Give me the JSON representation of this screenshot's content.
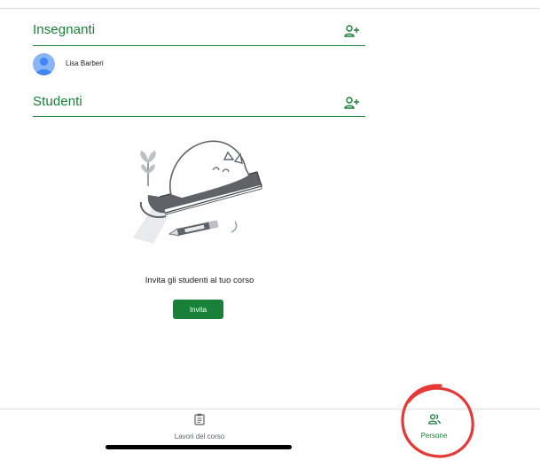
{
  "teachers_section": {
    "title": "Insegnanti",
    "add_icon": "person-add-icon"
  },
  "teachers": [
    {
      "name": "Lisa Barberi",
      "avatar_color": "#8ab4f8"
    }
  ],
  "students_section": {
    "title": "Studenti",
    "add_icon": "person-add-icon"
  },
  "empty_state": {
    "message": "Invita gli studenti al tuo corso",
    "button_label": "Invita",
    "illustration": "cat-on-book-illustration"
  },
  "bottom_nav": {
    "items": [
      {
        "label": "Lavori del corso",
        "icon": "clipboard-icon",
        "active": false
      },
      {
        "label": "Persone",
        "icon": "people-icon",
        "active": true
      }
    ]
  },
  "annotation": {
    "type": "hand-drawn circle",
    "color": "#e53935"
  },
  "colors": {
    "accent": "#188038",
    "text": "#202124",
    "muted": "#5f6368"
  }
}
